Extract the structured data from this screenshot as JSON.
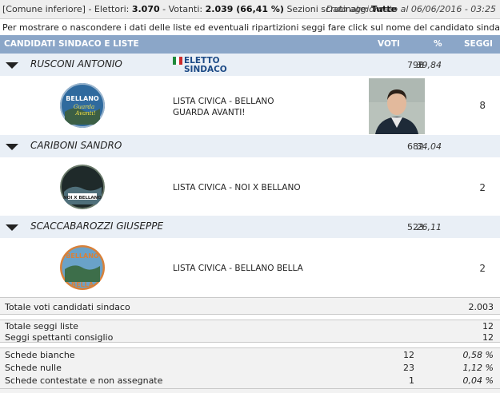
{
  "header": {
    "section": "[Comune inferiore]",
    "electors_label": "- Elettori:",
    "electors": "3.070",
    "voters_label": "- Votanti:",
    "voters": "2.039 (66,41 %)",
    "sections_label": "Sezioni scrutinate:",
    "sections": "Tutte",
    "updated": "Dato aggiornato al 06/06/2016 - 03:25"
  },
  "hint": "Per mostrare o nascondere i dati delle liste ed eventuali ripartizioni seggi fare click sul nome del candidato sindaco",
  "table_header": {
    "candidates": "CANDIDATI SINDACO E LISTE",
    "votes": "VOTI",
    "percent": "%",
    "seats": "SEGGI"
  },
  "candidates": [
    {
      "name": "RUSCONI ANTONIO",
      "votes": "798",
      "percent": "39,84",
      "elected_line1": "ELETTO",
      "elected_line2": "SINDACO",
      "list_name_line1": "LISTA CIVICA - BELLANO",
      "list_name_line2": "GUARDA AVANTI!",
      "logo_text_line1": "BELLANO",
      "logo_text_line2": "Guarda",
      "logo_text_line3": "Avanti!",
      "seats": "8"
    },
    {
      "name": "CARIBONI SANDRO",
      "votes": "682",
      "percent": "34,04",
      "list_name_line1": "LISTA CIVICA - NOI X BELLANO",
      "logo_text_line1": "NOI X BELLANO",
      "seats": "2"
    },
    {
      "name": "SCACCABAROZZI GIUSEPPE",
      "votes": "523",
      "percent": "26,11",
      "list_name_line1": "LISTA CIVICA - BELLANO BELLA",
      "logo_text_line1": "BELLANO",
      "logo_text_line2": "BELLA",
      "seats": "2"
    }
  ],
  "summary": {
    "total_votes_label": "Totale voti candidati sindaco",
    "total_votes": "2.003",
    "total_list_seats_label": "Totale seggi liste",
    "total_list_seats": "12",
    "council_seats_label": "Seggi spettanti consiglio",
    "council_seats": "12",
    "blank_label": "Schede bianche",
    "blank": "12",
    "blank_pct": "0,58 %",
    "null_label": "Schede nulle",
    "null": "23",
    "null_pct": "1,12 %",
    "contested_label": "Schede contestate e non assegnate",
    "contested": "1",
    "contested_pct": "0,04 %"
  },
  "colors": {
    "header_bg": "#8ba6c8",
    "candidate_row_bg": "#e9eff6",
    "elected_blue": "#1c4a86"
  }
}
